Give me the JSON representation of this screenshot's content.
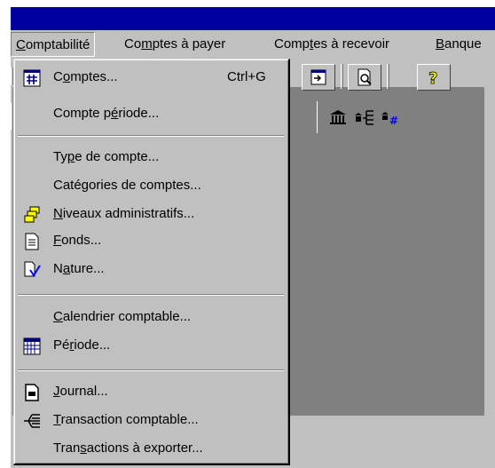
{
  "menubar": {
    "items": [
      {
        "pre": "",
        "ul": "C",
        "post": "omptabilité"
      },
      {
        "pre": "Co",
        "ul": "m",
        "post": "ptes à payer"
      },
      {
        "pre": "Comp",
        "ul": "t",
        "post": "es à recevoir"
      },
      {
        "pre": "",
        "ul": "B",
        "post": "anque"
      }
    ]
  },
  "toolbar": {
    "buttons": [
      "export-icon",
      "print-preview-icon",
      "help-icon"
    ],
    "flat": [
      "bank-icon",
      "bank-tree-icon",
      "bank-number-icon",
      "bank-check-icon"
    ]
  },
  "menu": {
    "items": [
      {
        "pre": "C",
        "ul": "o",
        "post": "mptes...",
        "accel": "Ctrl+G",
        "icon": "accounts-grid-icon"
      },
      {
        "pre": "Compte p",
        "ul": "é",
        "post": "riode...",
        "accel": "",
        "icon": ""
      },
      {
        "pre": "Ty",
        "ul": "p",
        "post": "e de compte...",
        "accel": "",
        "icon": ""
      },
      {
        "pre": "Catégories de comptes...",
        "ul": "",
        "post": "",
        "accel": "",
        "icon": ""
      },
      {
        "pre": "",
        "ul": "N",
        "post": "iveaux administratifs...",
        "accel": "",
        "icon": "admin-levels-icon"
      },
      {
        "pre": "",
        "ul": "F",
        "post": "onds...",
        "accel": "",
        "icon": "document-icon"
      },
      {
        "pre": "N",
        "ul": "a",
        "post": "ture...",
        "accel": "",
        "icon": "nature-check-icon"
      },
      {
        "pre": "",
        "ul": "C",
        "post": "alendrier comptable...",
        "accel": "",
        "icon": ""
      },
      {
        "pre": "Pé",
        "ul": "r",
        "post": "iode...",
        "accel": "",
        "icon": "calendar-grid-icon"
      },
      {
        "pre": "",
        "ul": "J",
        "post": "ournal...",
        "accel": "",
        "icon": "journal-icon"
      },
      {
        "pre": "",
        "ul": "T",
        "post": "ransaction comptable...",
        "accel": "",
        "icon": "transaction-tree-icon"
      },
      {
        "pre": "Tran",
        "ul": "s",
        "post": "actions à exporter...",
        "accel": "",
        "icon": ""
      }
    ]
  }
}
